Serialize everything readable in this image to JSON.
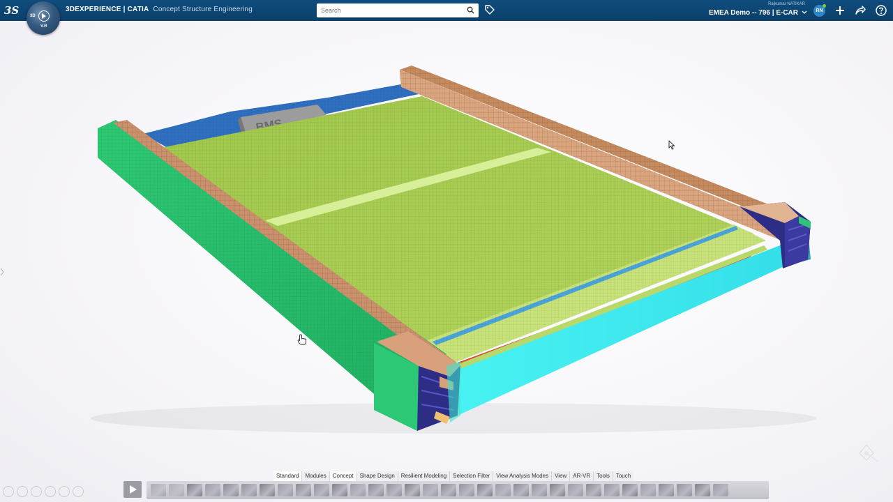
{
  "header": {
    "logo_text": "3S",
    "compass_left": "3D",
    "compass_right": "V.R",
    "brand": "3DEXPERIENCE | CATIA",
    "app_name": "Concept Structure Engineering",
    "search_placeholder": "Search",
    "user_name": "Rajkumar NATIKAR",
    "tenant": "EMEA Demo -- 796 | E-CAR",
    "avatar_initials": "RN"
  },
  "model": {
    "label": "BMS",
    "colors": {
      "floor": "#a4c84e",
      "floor_highlight": "#d9f09a",
      "left_rail": "#27c070",
      "right_rail_front": "#3ef0ee",
      "rear_sill": "#c48a5e",
      "cross_member_top": "#c9906b",
      "back_wall": "#2f6fc0",
      "inner_dark": "#2d2d86",
      "red_strip": "#d84a2a",
      "cooling_strip": "#4aa4d8"
    }
  },
  "section_tabs": [
    "Standard",
    "Modules",
    "Concept",
    "Shape Design",
    "Resilient Modeling",
    "Selection Filter",
    "View Analysis Modes",
    "View",
    "AR-VR",
    "Tools",
    "Touch"
  ],
  "active_tab": "Standard",
  "action_icons": [
    "undo-icon",
    "redo-icon",
    "point-icon",
    "line-icon",
    "plane-icon",
    "sketch-icon",
    "curve-icon",
    "spline-icon",
    "extrude-icon",
    "surface-icon",
    "fill-icon",
    "sweep-icon",
    "offset-icon",
    "join-icon",
    "split-icon",
    "trim-icon",
    "box-icon",
    "cylinder-icon",
    "beam-icon",
    "panel-icon",
    "mesh-icon",
    "cut-icon",
    "shell-icon",
    "section-icon",
    "measure-icon",
    "compass-icon",
    "update-icon",
    "export-icon",
    "arrow-down-icon",
    "arrow-down-icon",
    "settings-icon",
    "image-icon"
  ]
}
